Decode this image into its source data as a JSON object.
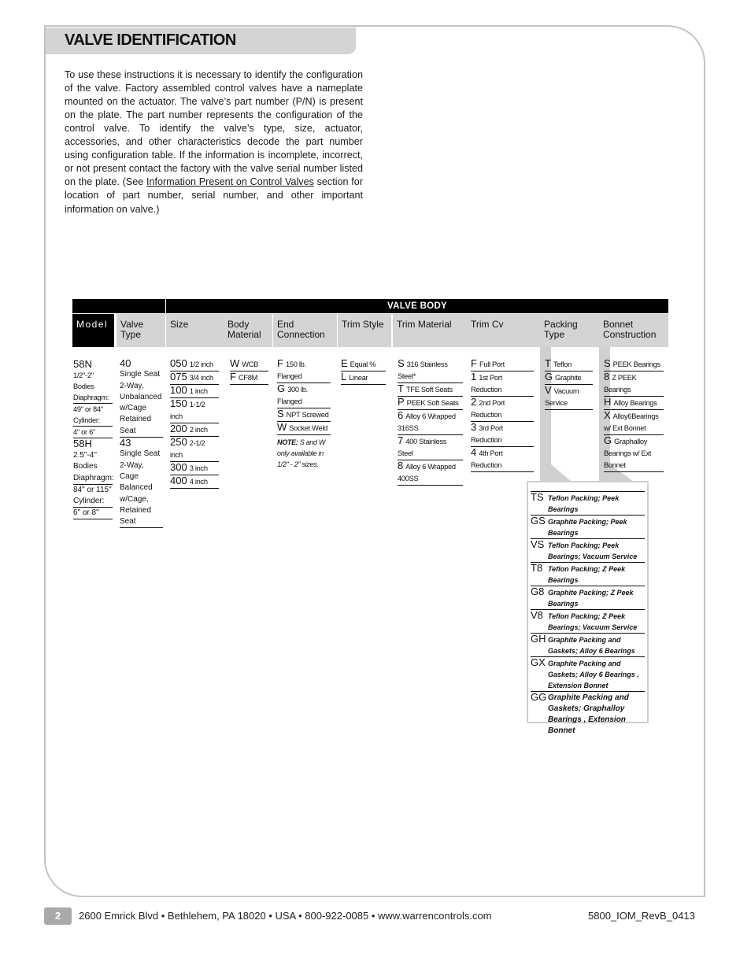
{
  "title": "VALVE IDENTIFICATION",
  "intro": {
    "before_link": "To use these instructions it is necessary to identify the configuration of the valve. Factory assembled control valves have a nameplate mounted on the actuator. The valve’s part number (P/N) is present on the plate. The part number represents the configuration of the control valve. To identify the valve’s type, size, actuator, accessories, and other characteristics decode the part number using configuration table. If the information is incomplete, incorrect, or not present contact the factory with the valve serial number listed on the plate. (See ",
    "link": "Information Present on Control Valves",
    "after_link": " section for location of part number, serial number, and other important information on valve.)"
  },
  "table": {
    "group_header": "VALVE BODY",
    "headers": [
      "Model",
      "Valve Type",
      "Size",
      "Body Material",
      "End Connection",
      "Trim Style",
      "Trim Material",
      "Trim Cv",
      "Packing Type",
      "Bonnet Construction"
    ],
    "model": [
      {
        "code": "58N",
        "lines": [
          "1/2\"-2\" Bodies",
          "Diaphragm:",
          "49\" or 84\"",
          "Cylinder:",
          "4\" or 6\""
        ]
      },
      {
        "code": "58H",
        "lines": [
          "2.5\"-4\"",
          "Bodies",
          "Diaphragm:",
          "84\" or 115\"",
          "Cylinder:",
          "6\" or 8\""
        ]
      }
    ],
    "valve_type": [
      {
        "code": "40",
        "desc": "Single Seat 2-Way, Unbalanced w/Cage Retained Seat"
      },
      {
        "code": "43",
        "desc": "Single Seat 2-Way, Cage Balanced w/Cage, Retained Seat"
      }
    ],
    "size": [
      {
        "code": "050",
        "desc": "1/2 inch"
      },
      {
        "code": "075",
        "desc": "3/4 inch"
      },
      {
        "code": "100",
        "desc": "1 inch"
      },
      {
        "code": "150",
        "desc": "1-1/2 inch"
      },
      {
        "code": "200",
        "desc": "2 inch"
      },
      {
        "code": "250",
        "desc": "2-1/2 inch"
      },
      {
        "code": "300",
        "desc": "3 inch"
      },
      {
        "code": "400",
        "desc": "4 inch"
      }
    ],
    "body_material": [
      {
        "code": "W",
        "desc": "WCB"
      },
      {
        "code": "F",
        "desc": "CF8M"
      }
    ],
    "end_connection": [
      {
        "code": "F",
        "desc": "150 lb. Flanged"
      },
      {
        "code": "G",
        "desc": "300 lb. Flanged"
      },
      {
        "code": "S",
        "desc": "NPT Screwed"
      },
      {
        "code": "W",
        "desc": "Socket Weld"
      }
    ],
    "end_connection_note": {
      "label": "NOTE:",
      "text": " S and W only available in 1/2\" - 2\" sizes."
    },
    "trim_style": [
      {
        "code": "E",
        "desc": "Equal %"
      },
      {
        "code": "L",
        "desc": "Linear"
      }
    ],
    "trim_material": [
      {
        "code": "S",
        "desc": "316 Stainless Steel*"
      },
      {
        "code": "T",
        "desc": "TFE Soft Seats"
      },
      {
        "code": "P",
        "desc": "PEEK Soft Seats"
      },
      {
        "code": "6",
        "desc": "Alloy 6 Wrapped 316SS"
      },
      {
        "code": "7",
        "desc": "400 Stainless Steel"
      },
      {
        "code": "8",
        "desc": "Alloy 6 Wrapped 400SS"
      }
    ],
    "trim_cv": [
      {
        "code": "F",
        "desc": "Full Port"
      },
      {
        "code": "1",
        "desc": "1st Port Reduction"
      },
      {
        "code": "2",
        "desc": "2nd Port Reduction"
      },
      {
        "code": "3",
        "desc": "3rd Port Reduction"
      },
      {
        "code": "4",
        "desc": "4th Port Reduction"
      }
    ],
    "packing_type": [
      {
        "code": "T",
        "desc": "Teflon"
      },
      {
        "code": "G",
        "desc": "Graphite"
      },
      {
        "code": "V",
        "desc": "Vacuum Service"
      }
    ],
    "bonnet_construction": [
      {
        "code": "S",
        "desc": "PEEK  Bearings"
      },
      {
        "code": "8",
        "desc": "Z PEEK Bearings"
      },
      {
        "code": "H",
        "desc": "Alloy Bearings"
      },
      {
        "code": "X",
        "desc": "Alloy6Bearings w/ Ext Bonnet"
      },
      {
        "code": "G",
        "desc": "Graphalloy Bearings w/ Ext Bonnet"
      }
    ],
    "combinations": [
      {
        "code": "TS",
        "desc": "Teflon Packing; Peek Bearings"
      },
      {
        "code": "GS",
        "desc": "Graphite Packing; Peek Bearings"
      },
      {
        "code": "VS",
        "desc": "Teflon Packing; Peek Bearings; Vacuum Service"
      },
      {
        "code": "T8",
        "desc": "Teflon Packing; Z Peek Bearings"
      },
      {
        "code": "G8",
        "desc": "Graphite Packing; Z Peek Bearings"
      },
      {
        "code": "V8",
        "desc": "Teflon Packing; Z Peek Bearings; Vacuum Service"
      },
      {
        "code": "GH",
        "desc": "Graphite Packing and Gaskets; Alloy 6 Bearings"
      },
      {
        "code": "GX",
        "desc": "Graphite Packing and Gaskets; Alloy 6 Bearings , Extension Bonnet"
      },
      {
        "code": "GG",
        "desc": "Graphite Packing and Gaskets; Graphalloy Bearings , Extension Bonnet"
      }
    ]
  },
  "footer": {
    "page_number": "2",
    "address": "2600 Emrick Blvd • Bethlehem, PA 18020 • USA • 800-922-0085 • www.warrencontrols.com",
    "doc_id": "5800_IOM_RevB_0413"
  }
}
